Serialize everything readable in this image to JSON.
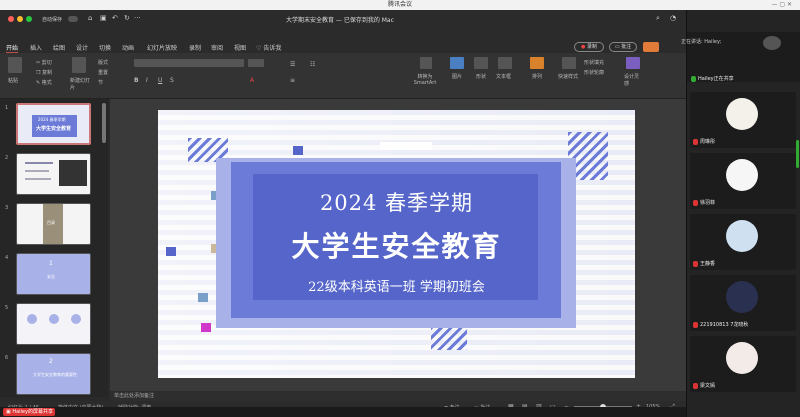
{
  "meeting": {
    "title": "腾讯会议",
    "speaking_prefix": "正在讲话:",
    "speaking_name": "Hailey;",
    "sharing_label": "Hailey正在共享",
    "sharing_tab": "Hailey的屏幕共享"
  },
  "ppt": {
    "autosave_label": "自动保存",
    "doc_title": "大学期末安全教育 — 已保存到我的 Mac",
    "record_button": "录制",
    "comment_button": "批注",
    "tabs": [
      "开始",
      "插入",
      "绘图",
      "设计",
      "切换",
      "动画",
      "幻灯片放映",
      "录制",
      "审阅",
      "视图",
      "告诉我"
    ],
    "ribbon": {
      "paste": "粘贴",
      "cut": "剪切",
      "copy": "复制",
      "format": "格式",
      "new_slide": "新建幻灯片",
      "layout": "版式",
      "reset": "重置",
      "section": "节",
      "smartart": "转换为SmartArt",
      "picture": "图片",
      "shape": "形状",
      "textbox": "文本框",
      "arrange": "排列",
      "quick_styles": "快速样式",
      "shape_fill": "形状填充",
      "shape_outline": "形状轮廓",
      "designer": "设计灵感"
    },
    "thumbnails": [
      {
        "num": "1",
        "title": "2024 春季学期",
        "subtitle": "大学生安全教育"
      },
      {
        "num": "2"
      },
      {
        "num": "3",
        "label": "目录"
      },
      {
        "num": "4",
        "label": "1",
        "sub": "安全"
      },
      {
        "num": "5"
      },
      {
        "num": "6",
        "label": "2",
        "sub": "大学生安全教育的重要性"
      }
    ],
    "slide": {
      "year_line": "2024  春季学期",
      "main_title": "大学生安全教育",
      "subtitle": "22级本科英语一班  学期初班会"
    },
    "notes_placeholder": "单击此处添加备注",
    "status": {
      "slide_count": "幻灯片 1 / 45",
      "language": "简体中文 (中国大陆)",
      "accessibility": "辅助功能: 调查",
      "notes": "备注",
      "comments": "批注",
      "zoom": "105%"
    }
  },
  "participants": [
    {
      "name": "周琳彤",
      "color": "#f4f1ea"
    },
    {
      "name": "徐羽菲",
      "color": "#f6f6f6"
    },
    {
      "name": "王静香",
      "color": "#cfe1f1"
    },
    {
      "name": "221910813 7龙晓秋",
      "color": "#2a3050"
    },
    {
      "name": "梁文嫣",
      "color": "#f3ebe8"
    }
  ],
  "colors": {
    "accent": "#c0504d",
    "slide_blue": "#6c7bd7",
    "slide_deep": "#5565c9",
    "slide_light": "#a8b1e8"
  }
}
